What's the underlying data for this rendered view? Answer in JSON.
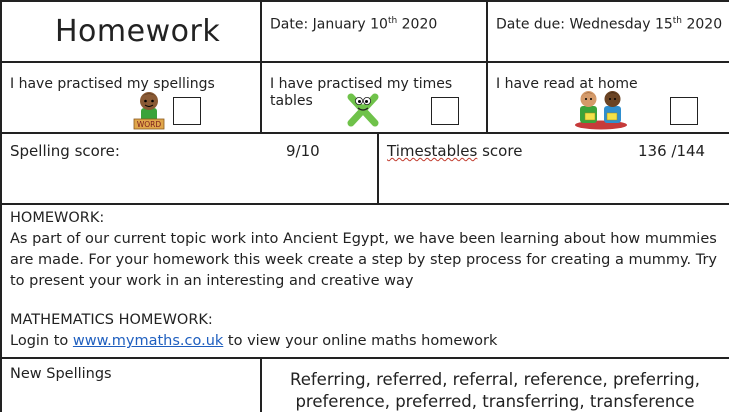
{
  "header": {
    "title": "Homework",
    "date_prefix": "Date: January 10",
    "date_sup": "th",
    "date_suffix": " 2020",
    "due_prefix": "Date due: Wednesday 15",
    "due_sup": "th",
    "due_suffix": " 2020"
  },
  "checklist": {
    "spellings_label": "I have practised my spellings",
    "times_tables_label": "I have practised my times tables",
    "reading_label": "I have read at home",
    "word_tile_text": "WORD"
  },
  "scores": {
    "spelling_label": "Spelling score:",
    "spelling_value": "9/10",
    "timestables_label_word": "Timestables",
    "timestables_label_rest": " score",
    "timestables_value": "136 /144"
  },
  "homework": {
    "heading": "HOMEWORK:",
    "body": "As part of our current topic work into Ancient Egypt, we have been learning about how mummies are made. For your homework this week create a step by step process for creating a mummy. Try to present your work in an interesting and creative way",
    "maths_heading": "MATHEMATICS HOMEWORK:",
    "maths_prefix": "Login to ",
    "maths_link": "www.mymaths.co.uk",
    "maths_suffix": " to view your online maths homework"
  },
  "spellings": {
    "label": "New Spellings",
    "words": "Referring, referred, referral, reference, preferring, preference, preferred, transferring, transference"
  }
}
